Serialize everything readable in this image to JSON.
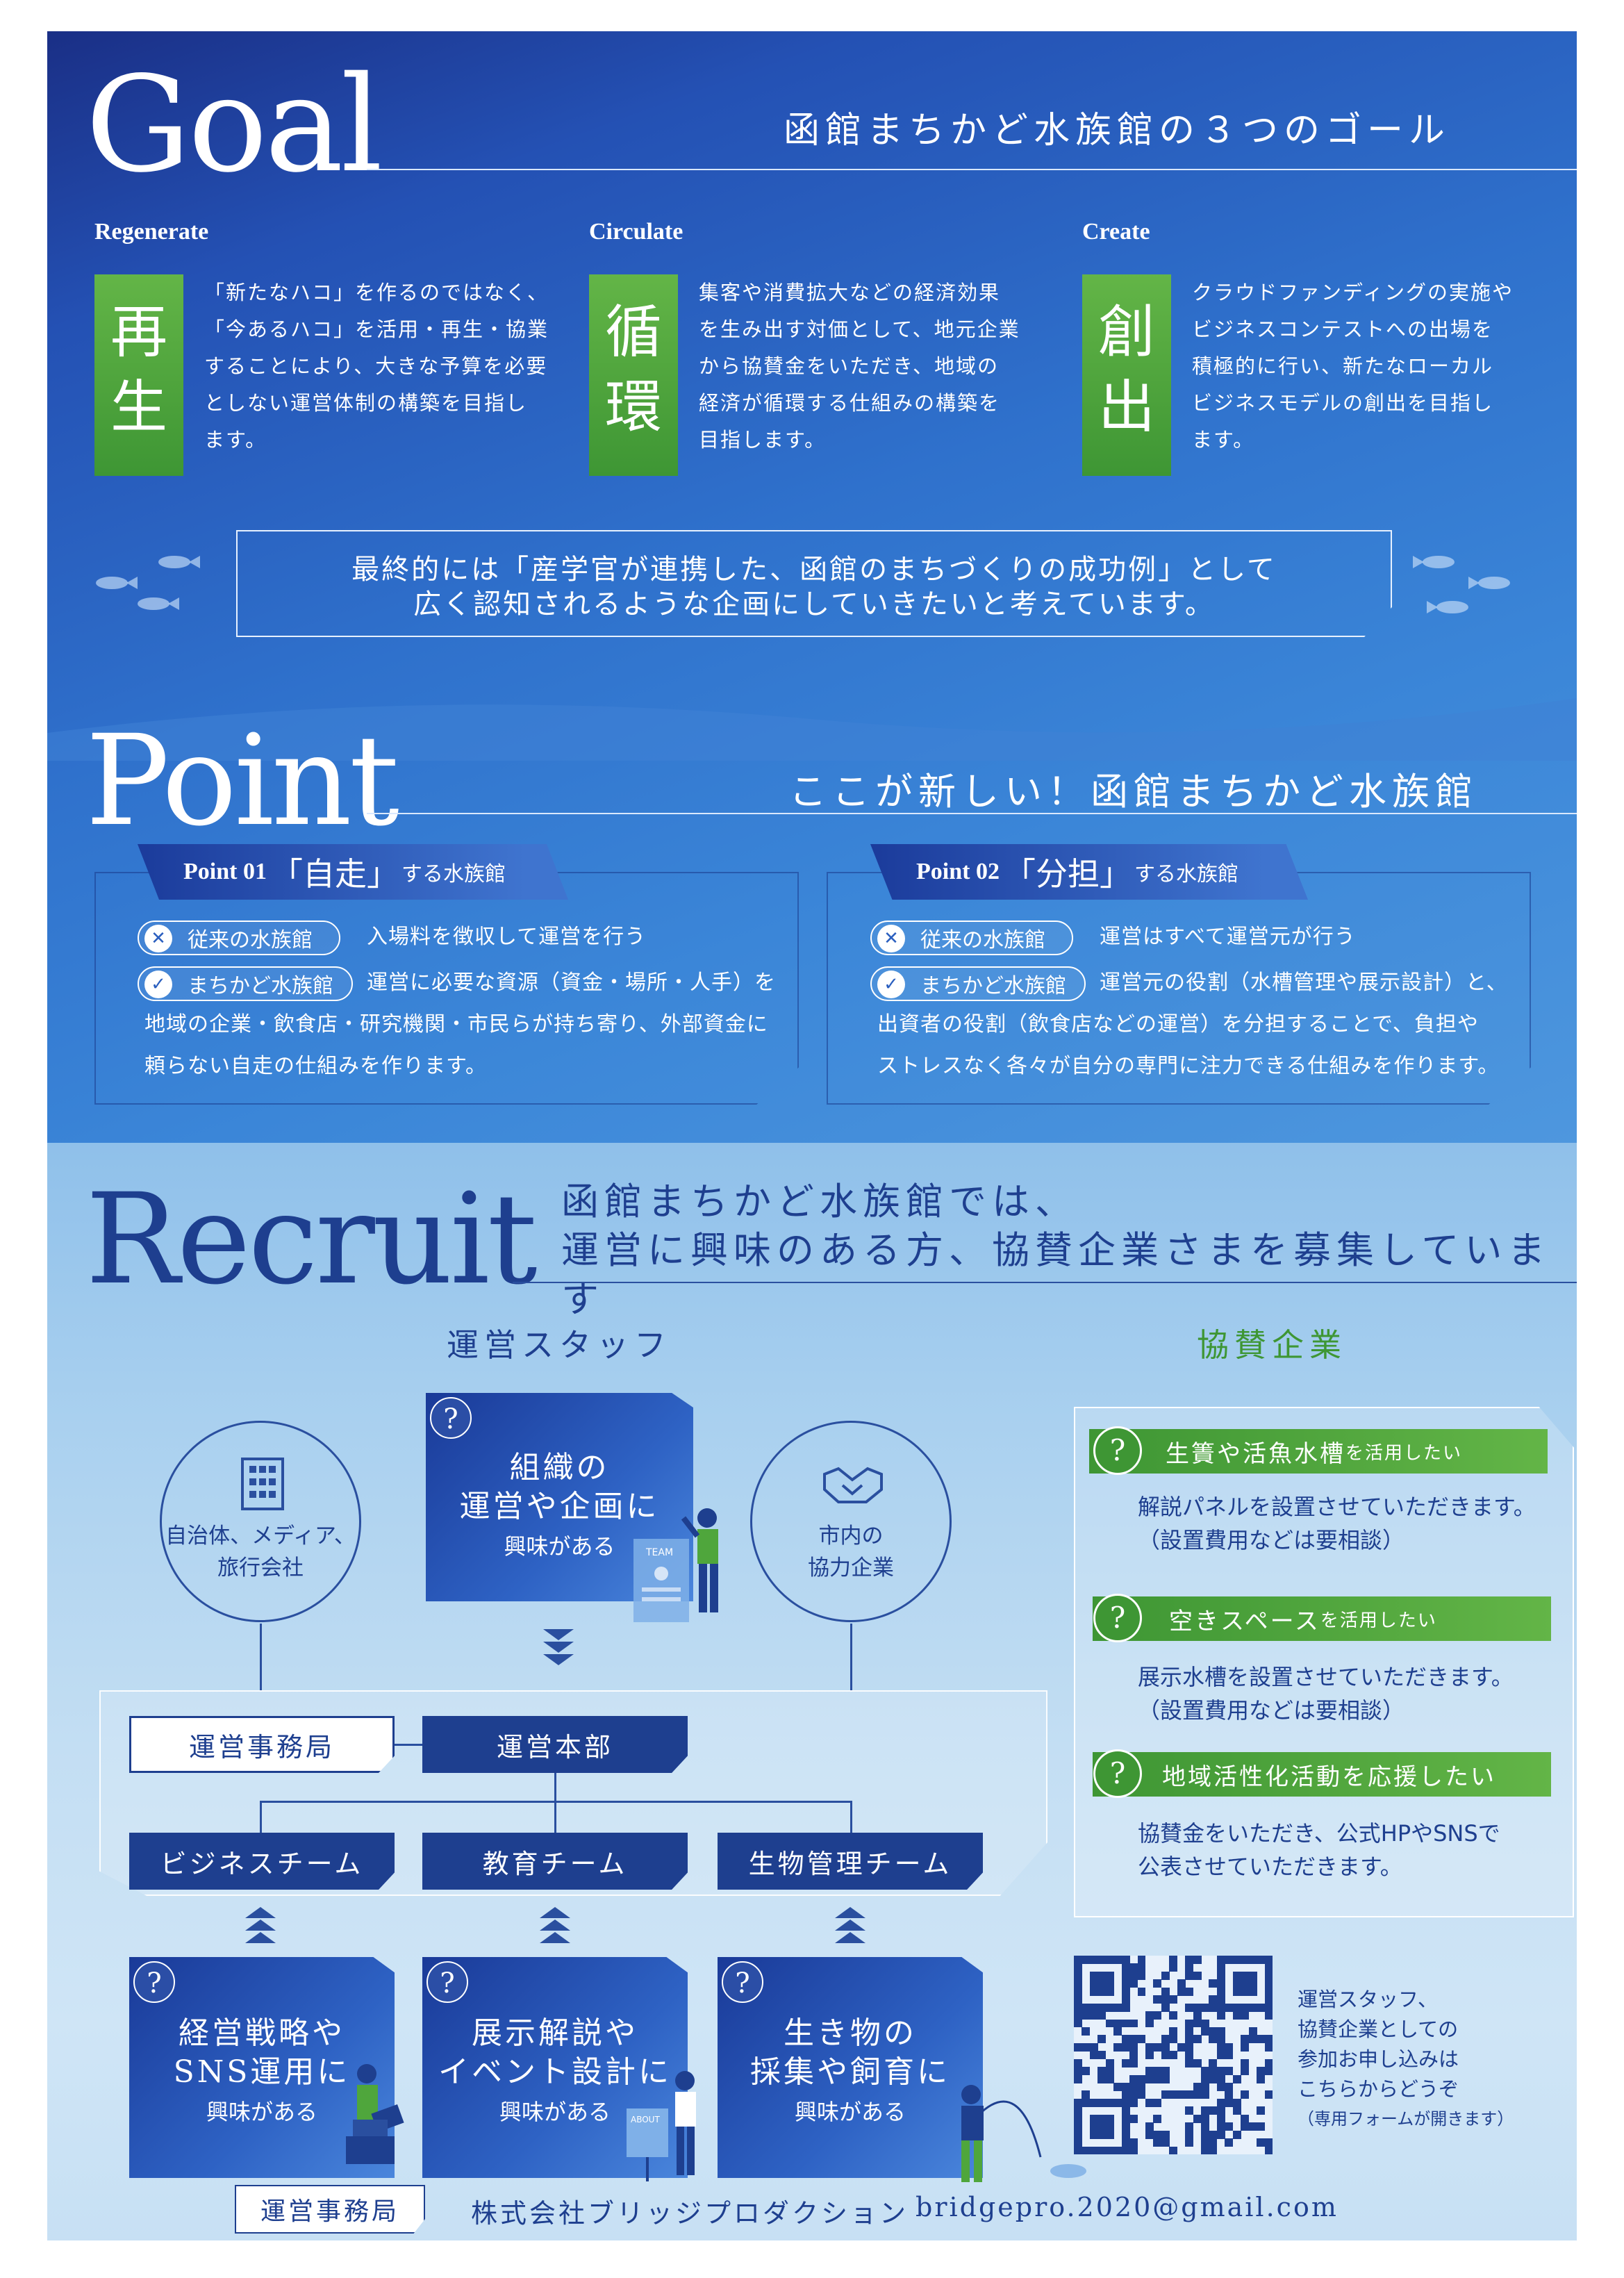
{
  "goal": {
    "title": "Goal",
    "subtitle": "函館まちかど水族館の３つのゴール",
    "items": [
      {
        "en": "Regenerate",
        "kanji1": "再",
        "kanji2": "生",
        "text": [
          "「新たなハコ」を作るのではなく、",
          "「今あるハコ」を活用・再生・協業",
          "することにより、大きな予算を必要",
          "としない運営体制の構築を目指し",
          "ます。"
        ]
      },
      {
        "en": "Circulate",
        "kanji1": "循",
        "kanji2": "環",
        "text": [
          "集客や消費拡大などの経済効果",
          "を生み出す対価として、地元企業",
          "から協賛金をいただき、地域の",
          "経済が循環する仕組みの構築を",
          "目指します。"
        ]
      },
      {
        "en": "Create",
        "kanji1": "創",
        "kanji2": "出",
        "text": [
          "クラウドファンディングの実施や",
          "ビジネスコンテストへの出場を",
          "積極的に行い、新たなローカル",
          "ビジネスモデルの創出を目指し",
          "ます。"
        ]
      }
    ],
    "final_line1": "最終的には「産学官が連携した、函館のまちづくりの成功例」として",
    "final_line2": "広く認知されるような企画にしていきたいと考えています。"
  },
  "point": {
    "title": "Point",
    "subtitle": "ここが新しい！函館まちかど水族館",
    "items": [
      {
        "num": "Point 01",
        "key": "「自走」",
        "suffix": "する水族館",
        "old_label": "従来の水族館",
        "old_text": "入場料を徴収して運営を行う",
        "new_label": "まちかど水族館",
        "new_text1": "運営に必要な資源（資金・場所・人手）を",
        "new_text2": "地域の企業・飲食店・研究機関・市民らが持ち寄り、外部資金に",
        "new_text3": "頼らない自走の仕組みを作ります。"
      },
      {
        "num": "Point 02",
        "key": "「分担」",
        "suffix": "する水族館",
        "old_label": "従来の水族館",
        "old_text": "運営はすべて運営元が行う",
        "new_label": "まちかど水族館",
        "new_text1": "運営元の役割（水槽管理や展示設計）と、",
        "new_text2": "出資者の役割（飲食店などの運営）を分担することで、負担や",
        "new_text3": "ストレスなく各々が自分の専門に注力できる仕組みを作ります。"
      }
    ],
    "cross_icon": "✕",
    "check_icon": "✓"
  },
  "recruit": {
    "title": "Recruit",
    "subtitle1": "函館まちかど水族館では、",
    "subtitle2": "運営に興味のある方、協賛企業さまを募集しています",
    "staff_heading": "運営スタッフ",
    "sponsor_heading": "協賛企業",
    "circle_left": [
      "自治体、メディア、",
      "旅行会社"
    ],
    "circle_right": [
      "市内の",
      "協力企業"
    ],
    "top_card": {
      "l1": "組織の",
      "l2": "運営や企画に",
      "l3": "興味がある"
    },
    "org_office": "運営事務局",
    "org_hq": "運営本部",
    "teams": [
      "ビジネスチーム",
      "教育チーム",
      "生物管理チーム"
    ],
    "bottom_cards": [
      {
        "l1": "経営戦略や",
        "l2": "SNS運用に",
        "l3": "興味がある"
      },
      {
        "l1": "展示解説や",
        "l2": "イベント設計に",
        "l3": "興味がある"
      },
      {
        "l1": "生き物の",
        "l2": "採集や飼育に",
        "l3": "興味がある"
      }
    ],
    "q_mark": "?",
    "sponsors": [
      {
        "label": "生簀や活魚水槽",
        "small": "を活用したい",
        "line1": "解説パネルを設置させていただきます。",
        "line2": "（設置費用などは要相談）"
      },
      {
        "label": "空きスペース",
        "small": "を活用したい",
        "line1": "展示水槽を設置させていただきます。",
        "line2": "（設置費用などは要相談）"
      },
      {
        "label": "地域活性化活動を応援したい",
        "small": "",
        "line1": "協賛金をいただき、公式HPやSNSで",
        "line2": "公表させていただきます。"
      }
    ],
    "qr_text": [
      "運営スタッフ、",
      "協賛企業としての",
      "参加お申し込みは",
      "こちらからどうぞ",
      "（専用フォームが開きます）"
    ],
    "footer_label": "運営事務局",
    "footer_company": "株式会社ブリッジプロダクション",
    "footer_email": "bridgepro.2020@gmail.com",
    "team_sign": "TEAM",
    "about_sign": "ABOUT"
  },
  "colors": {
    "navy": "#1e3f8f",
    "green": "#4fa63c",
    "blue": "#2f71cc",
    "light": "#c3def3"
  }
}
